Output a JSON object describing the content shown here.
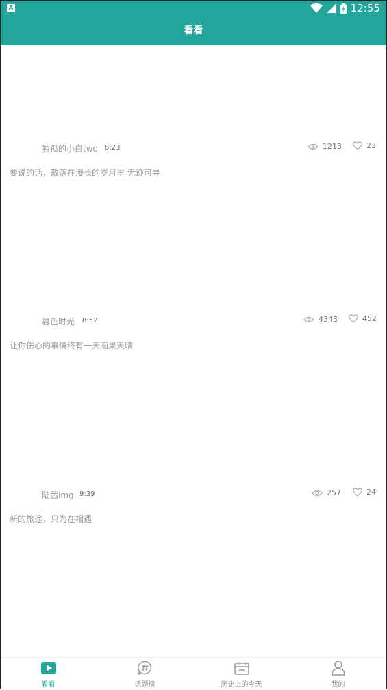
{
  "status_bar": {
    "time": "12:55",
    "indicator": "A"
  },
  "header": {
    "title": "看看"
  },
  "posts": [
    {
      "author": "独孤的小白two",
      "time": "8:23",
      "views": "1213",
      "likes": "23",
      "content": "要说的话，散落在漫长的岁月里  无迹可寻"
    },
    {
      "author": "暮色时光",
      "time": "8:52",
      "views": "4343",
      "likes": "452",
      "content": "让你伤心的事情终有一天雨果天晴"
    },
    {
      "author": "陆茜img",
      "time": "9:39",
      "views": "257",
      "likes": "24",
      "content": "新的旅途，只为在相遇"
    }
  ],
  "bottom_nav": [
    {
      "label": "看看",
      "icon": "play-icon",
      "active": true
    },
    {
      "label": "话题榜",
      "icon": "hashtag-chat-icon",
      "active": false
    },
    {
      "label": "历史上的今天",
      "icon": "calendar-icon",
      "active": false
    },
    {
      "label": "我的",
      "icon": "person-icon",
      "active": false
    }
  ],
  "colors": {
    "accent": "#23a59c",
    "muted_text": "#9a9a9a"
  }
}
